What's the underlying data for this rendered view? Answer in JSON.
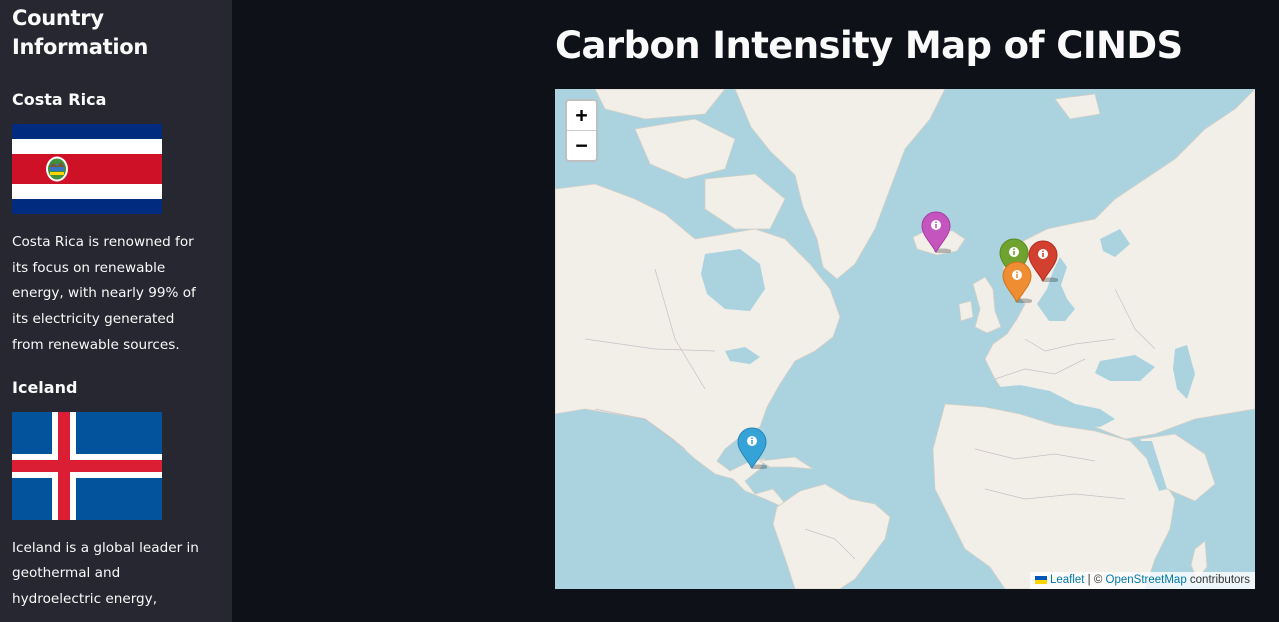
{
  "sidebar": {
    "heading": "Country Information",
    "countries": [
      {
        "name": "Costa Rica",
        "description": "Costa Rica is renowned for its focus on renewable energy, with nearly 99% of its electricity generated from renewable sources.",
        "flag_colors": {
          "blue": "#002b7f",
          "white": "#ffffff",
          "red": "#ce1126"
        }
      },
      {
        "name": "Iceland",
        "description": "Iceland is a global leader in geothermal and hydroelectric energy,",
        "flag_colors": {
          "blue": "#02529c",
          "white": "#ffffff",
          "red": "#dc1e35"
        }
      }
    ]
  },
  "main": {
    "title": "Carbon Intensity Map of CINDS"
  },
  "map": {
    "zoom_in_label": "+",
    "zoom_out_label": "−",
    "attribution": {
      "leaflet": "Leaflet",
      "separator": " | © ",
      "osm": "OpenStreetMap",
      "suffix": " contributors"
    },
    "colors": {
      "water": "#aad3df",
      "land": "#f2efe9"
    },
    "markers": [
      {
        "name": "marker-iceland",
        "color": "#c455bf",
        "icon": "info-icon"
      },
      {
        "name": "marker-norway",
        "color": "#6fa22f",
        "icon": "info-icon"
      },
      {
        "name": "marker-finland",
        "color": "#d3402f",
        "icon": "info-icon"
      },
      {
        "name": "marker-denmark",
        "color": "#ef8d32",
        "icon": "info-icon"
      },
      {
        "name": "marker-costa-rica",
        "color": "#36a3d8",
        "icon": "info-icon"
      }
    ]
  }
}
